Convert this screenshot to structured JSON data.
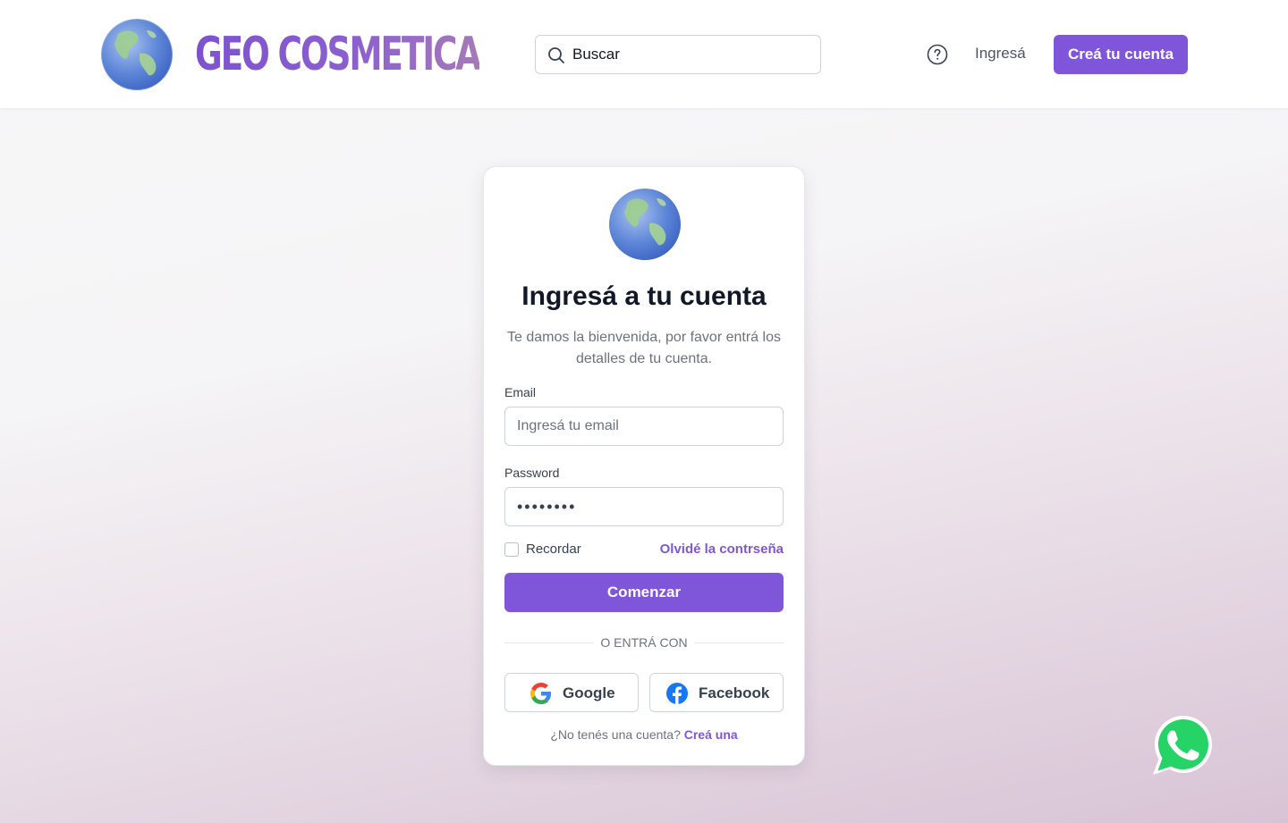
{
  "header": {
    "brand": "GEO COSMETICA",
    "search_placeholder": "Buscar",
    "help_icon": "question-circle-icon",
    "login_label": "Ingresá",
    "signup_label": "Creá tu cuenta"
  },
  "card": {
    "title": "Ingresá a tu cuenta",
    "subtitle": "Te damos la bienvenida, por favor entrá los detalles de tu cuenta.",
    "email_label": "Email",
    "email_placeholder": "Ingresá tu email",
    "password_label": "Password",
    "password_value": "••••••••",
    "remember_label": "Recordar",
    "forgot_label": "Olvidé la contrseña",
    "submit_label": "Comenzar",
    "divider_label": "O ENTRÁ CON",
    "google_label": "Google",
    "facebook_label": "Facebook",
    "footer_question": "¿No tenés una cuenta?",
    "footer_link": "Creá una"
  },
  "colors": {
    "accent": "#7f56d9",
    "whatsapp": "#25d366"
  },
  "icons": {
    "logo": "globe-icon",
    "search": "search-icon",
    "google": "google-icon",
    "facebook": "facebook-icon",
    "whatsapp": "whatsapp-icon"
  }
}
